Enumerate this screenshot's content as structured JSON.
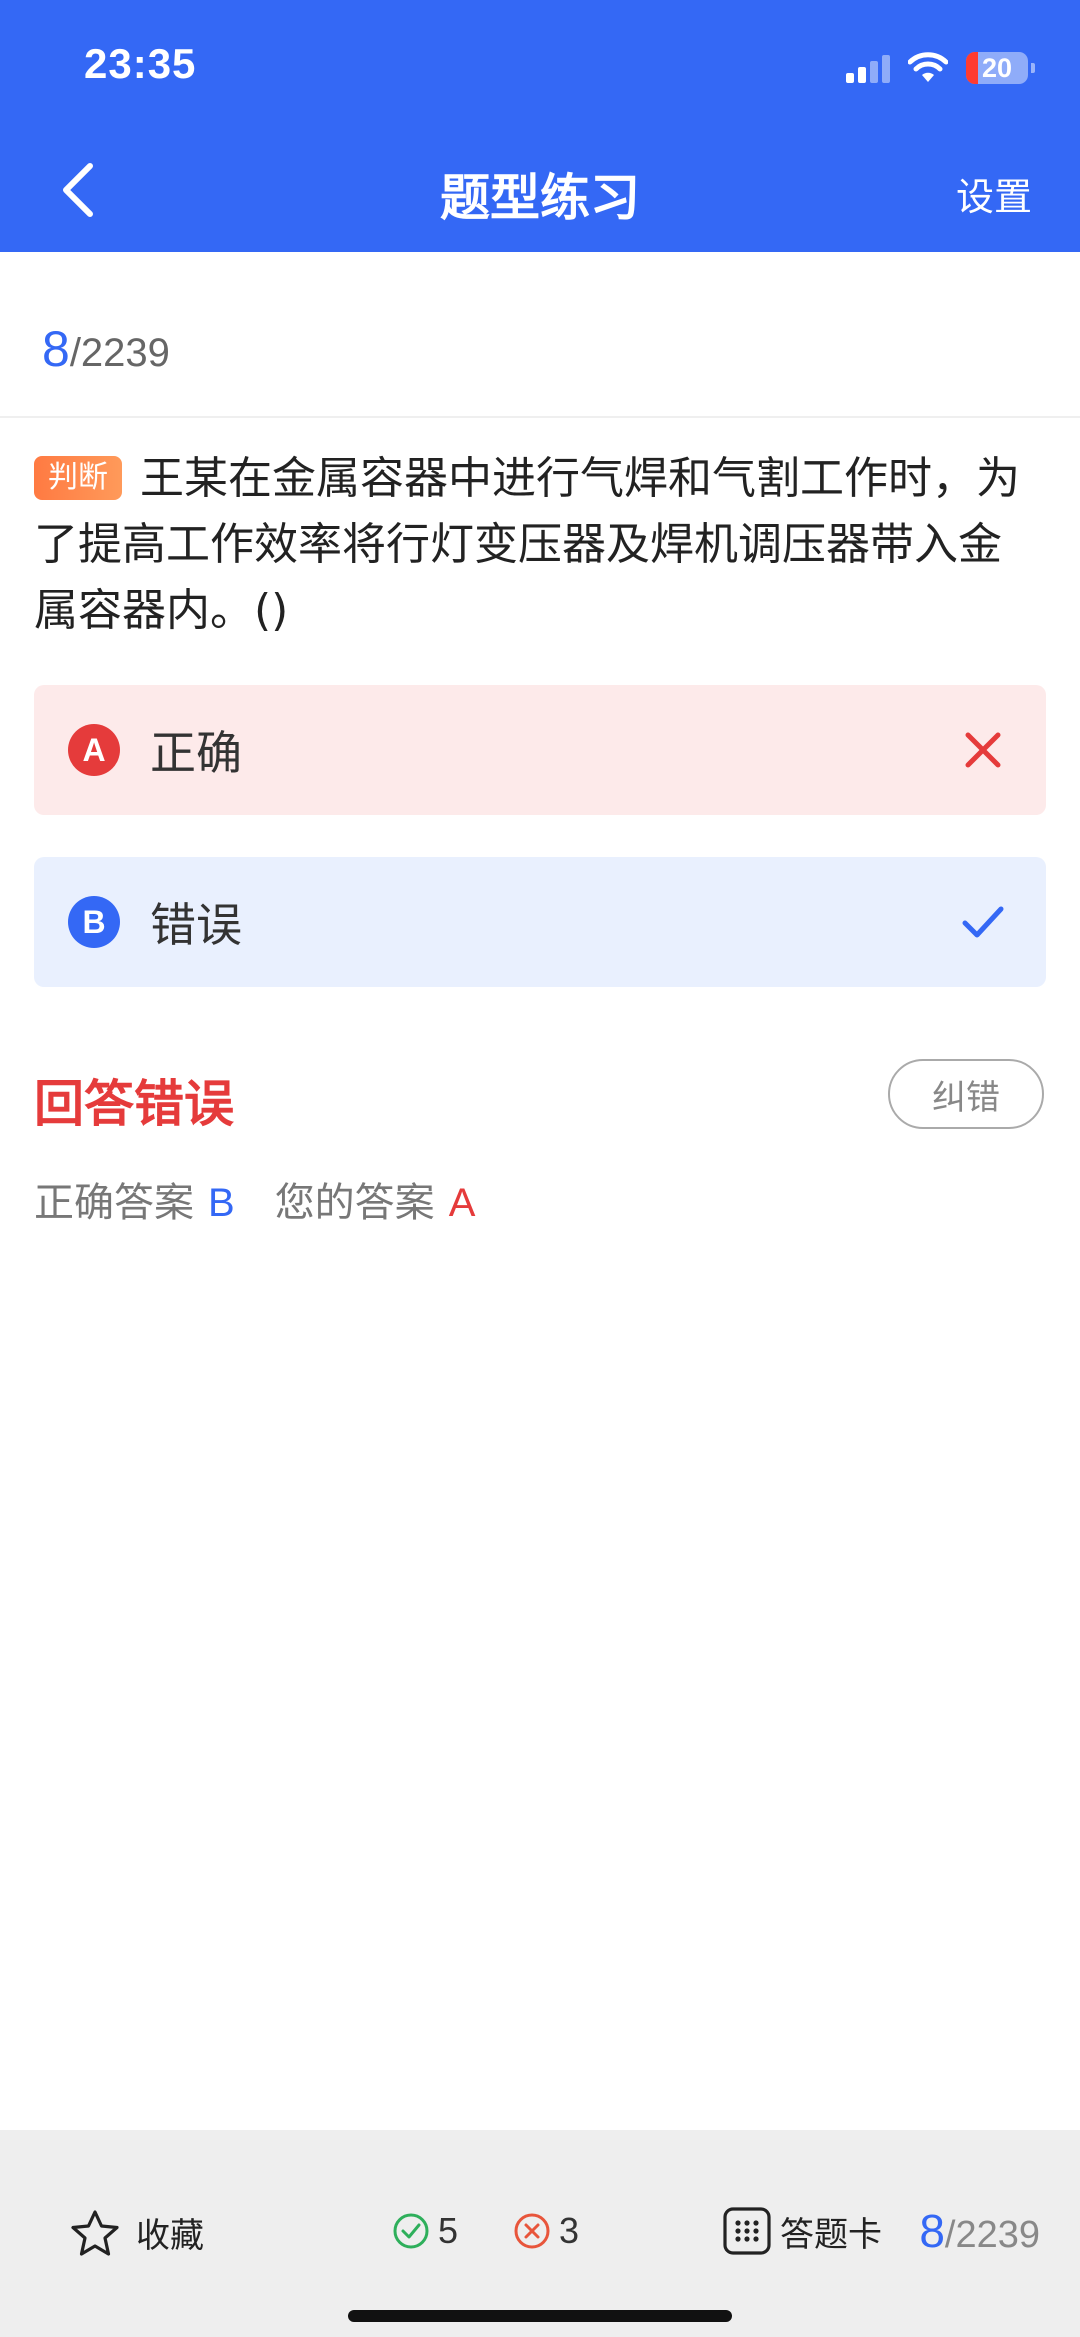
{
  "status_bar": {
    "time": "23:35",
    "battery": "20"
  },
  "header": {
    "title": "题型练习",
    "settings_label": "设置"
  },
  "progress": {
    "current": "8",
    "total": "/2239"
  },
  "question": {
    "type_tag": "判断",
    "text": "王某在金属容器中进行气焊和气割工作时，为了提高工作效率将行灯变压器及焊机调压器带入金属容器内。()"
  },
  "options": [
    {
      "letter": "A",
      "text": "正确",
      "state": "wrong"
    },
    {
      "letter": "B",
      "text": "错误",
      "state": "correct"
    }
  ],
  "result": {
    "title": "回答错误",
    "report_label": "纠错",
    "correct_label": "正确答案",
    "correct_value": "B",
    "yours_label": "您的答案",
    "yours_value": "A"
  },
  "bottom_bar": {
    "favorite_label": "收藏",
    "correct_count": "5",
    "wrong_count": "3",
    "card_label": "答题卡",
    "page_current": "8",
    "page_total": "/2239"
  },
  "colors": {
    "primary": "#3468F5",
    "error": "#E53B3B",
    "tag": "#FF7A42"
  }
}
